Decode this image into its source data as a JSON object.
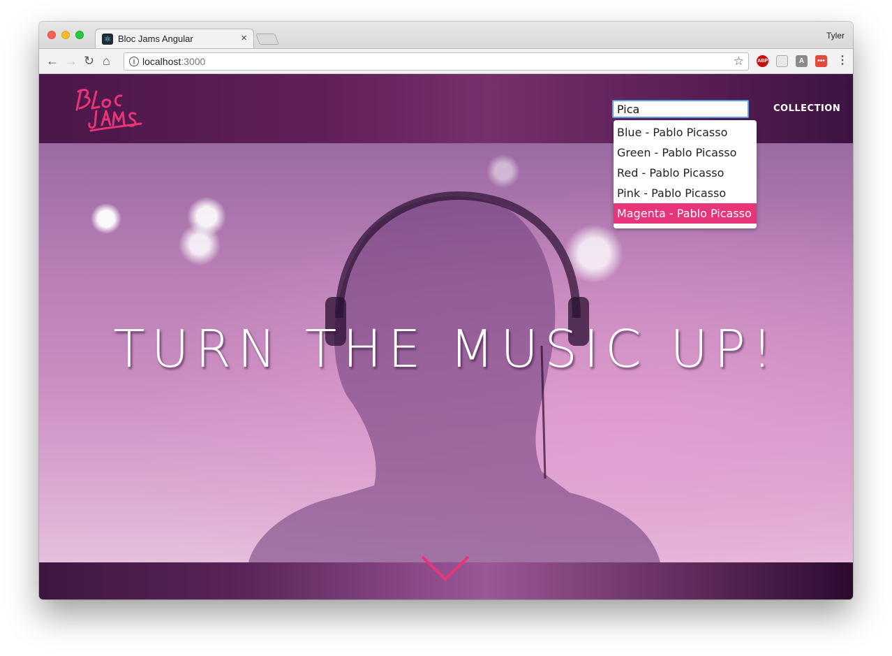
{
  "browser": {
    "tab_title": "Bloc Jams Angular",
    "tab_close": "×",
    "profile_name": "Tyler",
    "url_host": "localhost",
    "url_port": ":3000",
    "nav": {
      "back": "←",
      "forward": "→",
      "reload": "↻",
      "home": "⌂"
    },
    "star": "☆",
    "menu": "⋮",
    "extensions": [
      "ABP",
      "",
      "A",
      "•••"
    ]
  },
  "app": {
    "logo_text": "Bloc Jams",
    "search": {
      "value": "Pica"
    },
    "nav_link": "COLLECTION",
    "suggestions": [
      {
        "label": "Blue - Pablo Picasso",
        "active": false
      },
      {
        "label": "Green - Pablo Picasso",
        "active": false
      },
      {
        "label": "Red - Pablo Picasso",
        "active": false
      },
      {
        "label": "Pink - Pablo Picasso",
        "active": false
      },
      {
        "label": "Magenta - Pablo Picasso",
        "active": true
      }
    ],
    "hero_title": "TURN THE MUSIC UP!"
  },
  "colors": {
    "accent": "#e8357a",
    "navbar": "#5e1f58",
    "focus_ring": "#5b9de8"
  }
}
